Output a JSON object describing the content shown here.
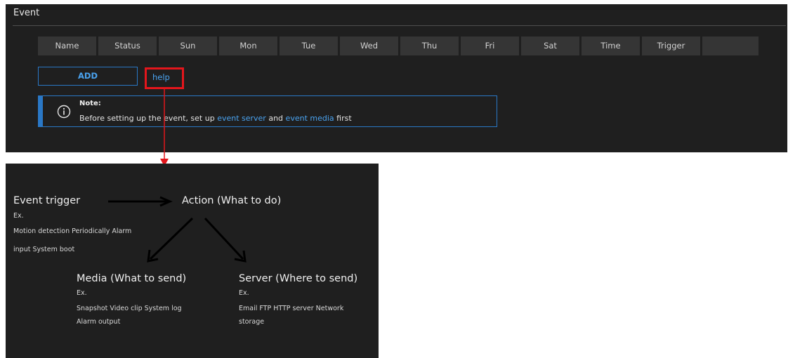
{
  "event_panel": {
    "title": "Event",
    "columns": [
      "Name",
      "Status",
      "Sun",
      "Mon",
      "Tue",
      "Wed",
      "Thu",
      "Fri",
      "Sat",
      "Time",
      "Trigger",
      ""
    ],
    "add_label": "ADD",
    "help_label": "help",
    "note": {
      "title": "Note:",
      "text_before": "Before setting up the event, set up ",
      "link_event_server": "event server",
      "text_middle": " and ",
      "link_event_media": "event media",
      "text_after": " first"
    }
  },
  "help_diagram": {
    "event_trigger": {
      "title": "Event trigger",
      "ex": "Ex.",
      "line1": "Motion detection  Periodically  Alarm",
      "line2": "input  System boot"
    },
    "action": {
      "title": "Action (What to do)"
    },
    "media": {
      "title": "Media (What to send)",
      "ex": "Ex.",
      "line1": "Snapshot  Video clip  System log",
      "line2": "Alarm output"
    },
    "server": {
      "title": "Server (Where to send)",
      "ex": "Ex.",
      "line1": "Email  FTP  HTTP server  Network",
      "line2": "storage"
    }
  },
  "colors": {
    "panel_bg": "#1f1f1f",
    "header_cell_bg": "#353535",
    "accent_blue": "#2a78c6",
    "link_blue": "#4aa3f0",
    "highlight_red": "#e3161c"
  },
  "icons": {
    "note": "info-circle-icon",
    "connector": "arrow-down-icon"
  }
}
